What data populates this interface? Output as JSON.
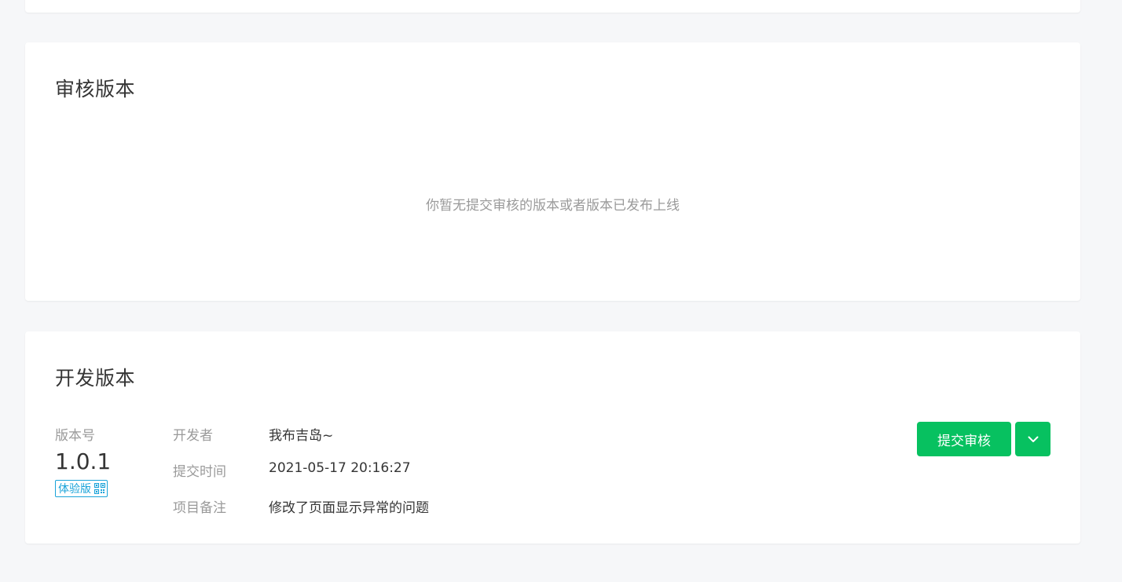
{
  "review_section": {
    "title": "审核版本",
    "empty_message": "你暂无提交审核的版本或者版本已发布上线"
  },
  "dev_section": {
    "title": "开发版本",
    "version_label": "版本号",
    "version_number": "1.0.1",
    "badge_label": "体验版",
    "fields": [
      {
        "key": "开发者",
        "value": "我布吉岛~"
      },
      {
        "key": "提交时间",
        "value": "2021-05-17 20:16:27"
      },
      {
        "key": "项目备注",
        "value": "修改了页面显示异常的问题"
      }
    ],
    "submit_button_label": "提交审核"
  },
  "icons": {
    "badge_icon": "qrcode-icon",
    "dropdown_icon": "chevron-down-icon"
  },
  "colors": {
    "primary": "#07c160",
    "badge": "#1aa3d9",
    "muted_text": "#9a9a9a",
    "text": "#353535",
    "page_bg": "#f6f7f9"
  }
}
